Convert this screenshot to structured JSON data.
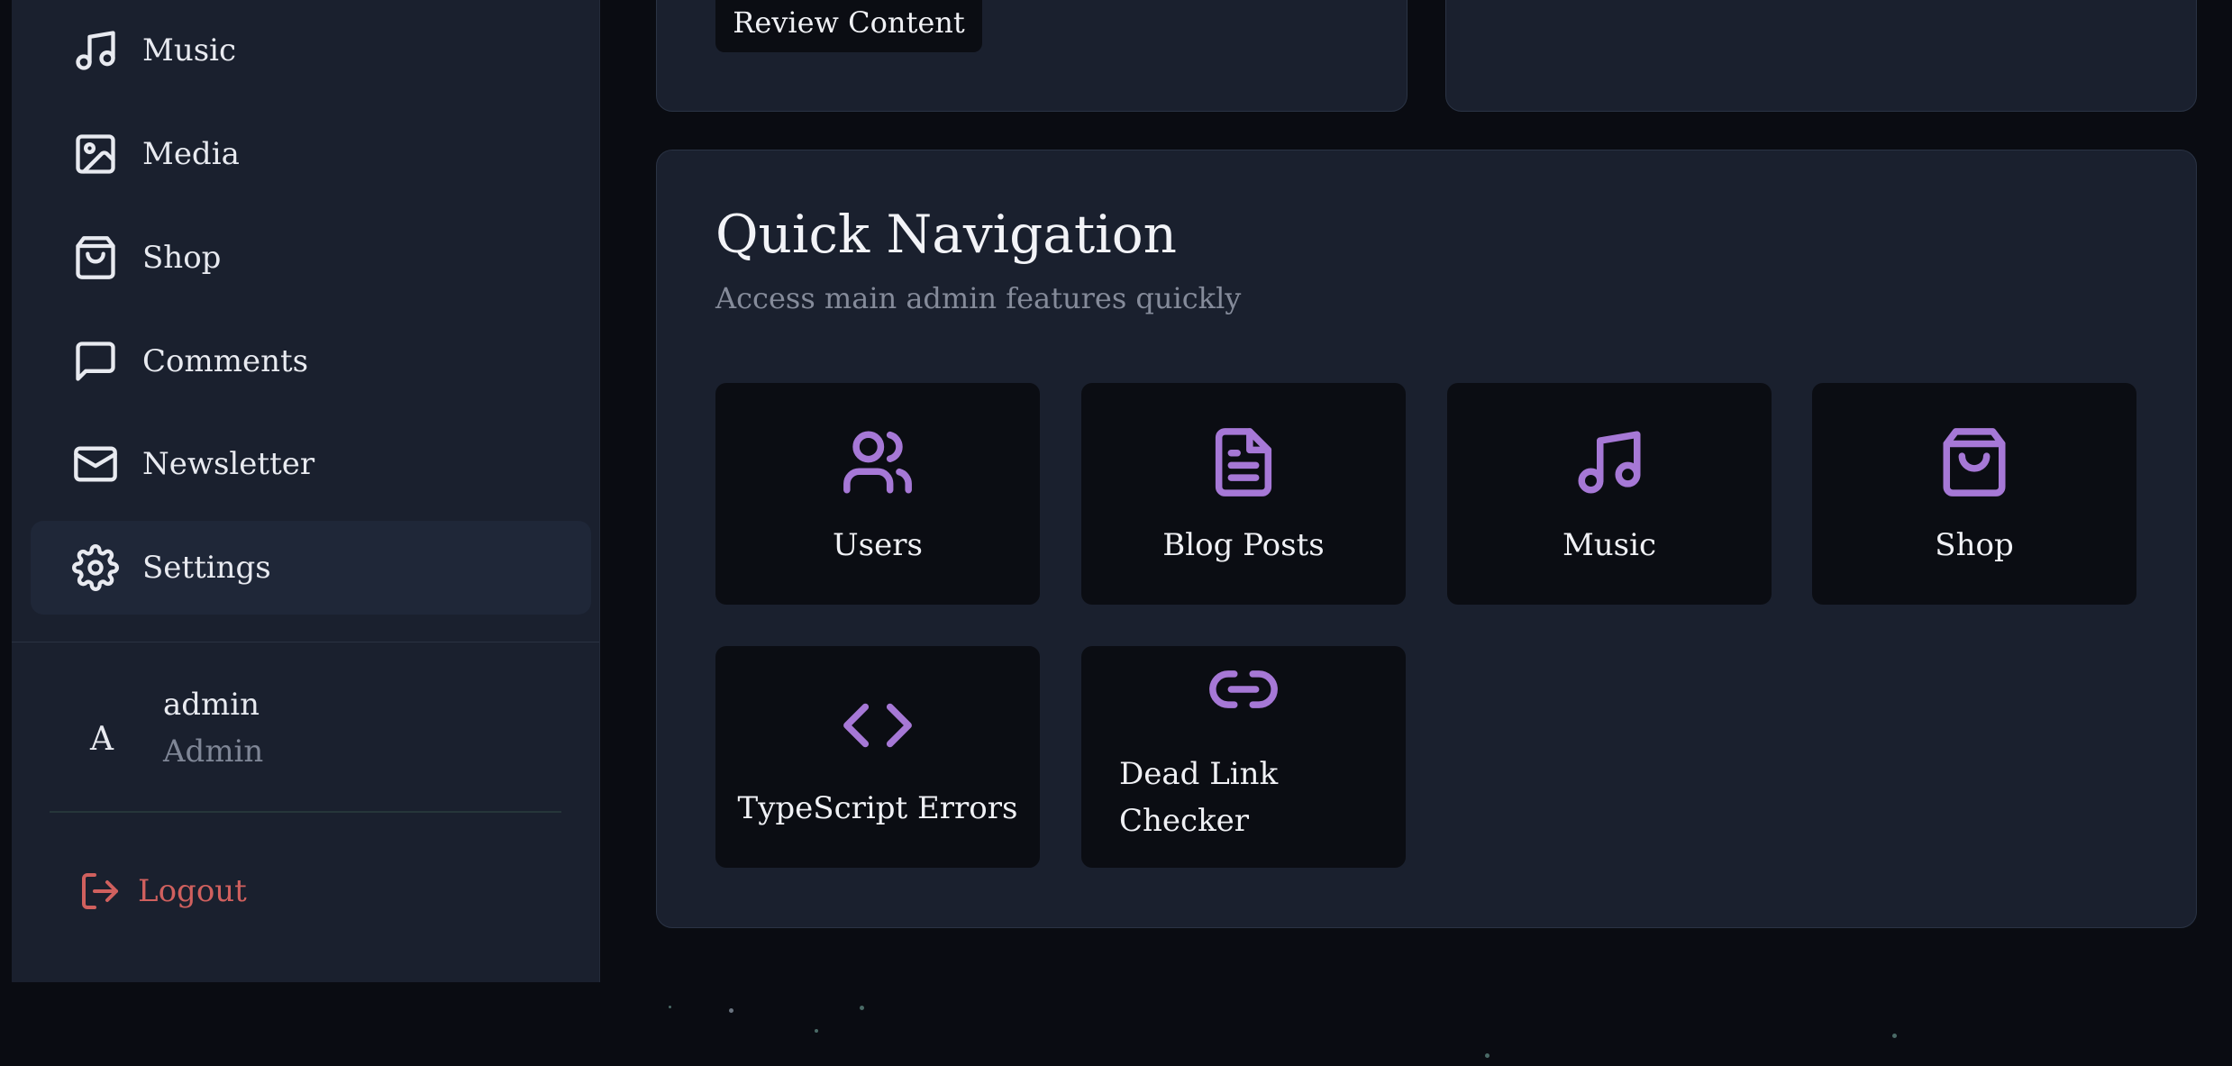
{
  "sidebar": {
    "items": [
      {
        "label": "Music",
        "icon": "music-icon"
      },
      {
        "label": "Media",
        "icon": "image-icon"
      },
      {
        "label": "Shop",
        "icon": "shopping-bag-icon"
      },
      {
        "label": "Comments",
        "icon": "message-square-icon"
      },
      {
        "label": "Newsletter",
        "icon": "mail-icon"
      },
      {
        "label": "Settings",
        "icon": "settings-icon",
        "active": true
      }
    ],
    "user": {
      "initial": "A",
      "name": "admin",
      "role": "Admin"
    },
    "logout_label": "Logout"
  },
  "top_card": {
    "button_label": "Review Content"
  },
  "quick_nav": {
    "title": "Quick Navigation",
    "subtitle": "Access main admin features quickly",
    "tiles": [
      {
        "label": "Users",
        "icon": "users-icon"
      },
      {
        "label": "Blog Posts",
        "icon": "file-text-icon"
      },
      {
        "label": "Music",
        "icon": "music-icon"
      },
      {
        "label": "Shop",
        "icon": "shopping-bag-icon"
      },
      {
        "label": "TypeScript Errors",
        "icon": "code-icon"
      },
      {
        "label": "Dead Link Checker",
        "icon": "link-icon"
      }
    ]
  },
  "colors": {
    "accent": "#a678d6",
    "logout": "#d0605e",
    "background": "#0a0c12",
    "panel": "#1a202e"
  }
}
